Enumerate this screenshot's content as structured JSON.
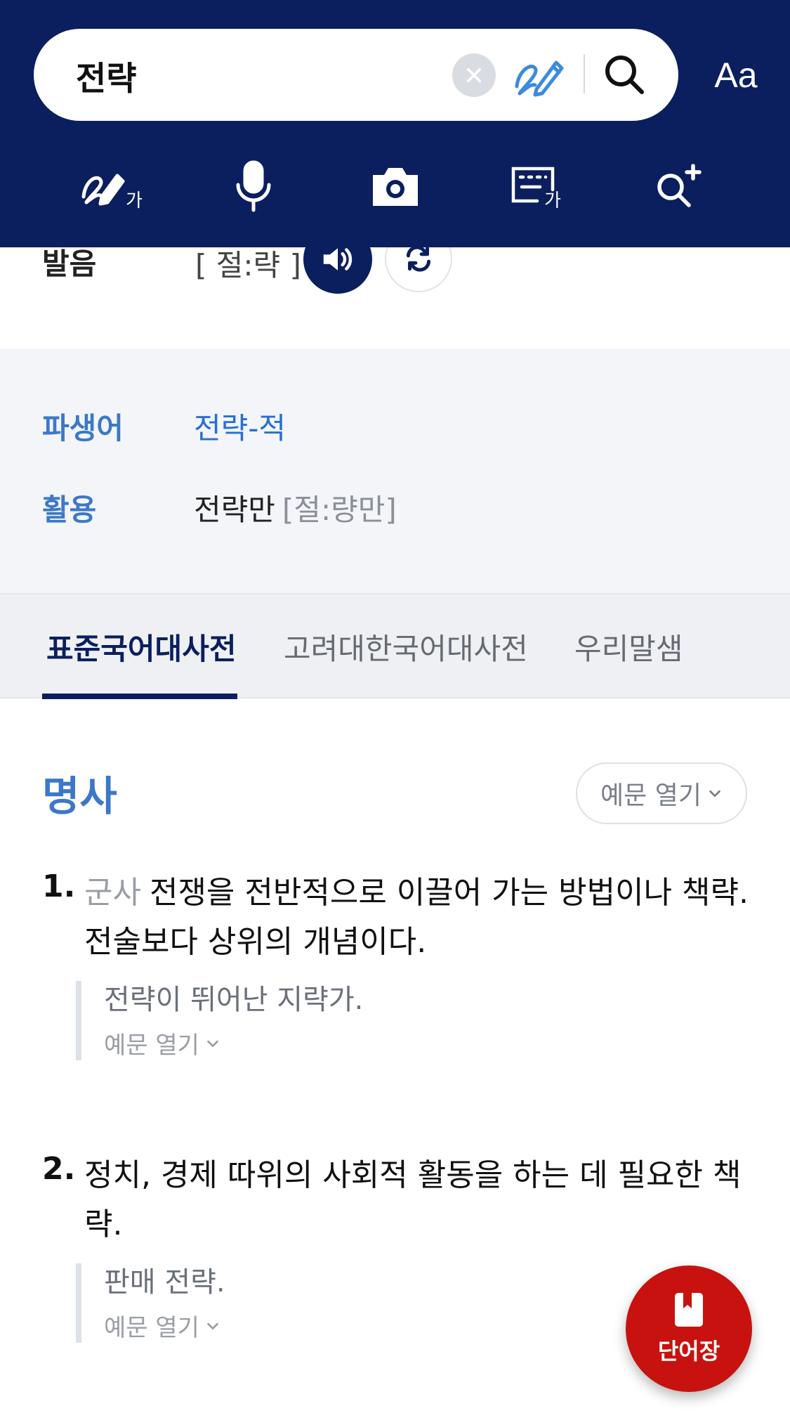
{
  "search": {
    "value": "전략"
  },
  "header": {
    "font_size_label": "Aa"
  },
  "tools": [
    {
      "name": "handwriting-input-icon"
    },
    {
      "name": "microphone-icon"
    },
    {
      "name": "camera-icon"
    },
    {
      "name": "keyboard-input-icon"
    },
    {
      "name": "detailed-search-icon"
    }
  ],
  "pronunciation": {
    "label": "발음",
    "value": "[ 절:략 ]"
  },
  "info": {
    "derivative": {
      "label": "파생어",
      "value": "전략-적"
    },
    "conjugation": {
      "label": "활용",
      "word": "전략만",
      "pron": "[절:량만]"
    }
  },
  "tabs": [
    {
      "label": "표준국어대사전",
      "active": true
    },
    {
      "label": "고려대한국어대사전",
      "active": false
    },
    {
      "label": "우리말샘",
      "active": false
    }
  ],
  "entry": {
    "part_of_speech": "명사",
    "example_toggle_label": "예문 열기",
    "senses": [
      {
        "number": "1.",
        "field": "군사",
        "definition": "전쟁을 전반적으로 이끌어 가는 방법이나 책략. 전술보다 상위의 개념이다.",
        "example": "전략이 뛰어난 지략가.",
        "more_label": "예문 열기"
      },
      {
        "number": "2.",
        "field": "",
        "definition": "정치, 경제 따위의 사회적 활동을 하는 데 필요한 책략.",
        "example": "판매 전략.",
        "more_label": "예문 열기"
      }
    ]
  },
  "fab": {
    "label": "단어장"
  },
  "colors": {
    "header_bg": "#0b1f5e",
    "accent_blue": "#3d78c6",
    "fab_red": "#c8120f"
  }
}
